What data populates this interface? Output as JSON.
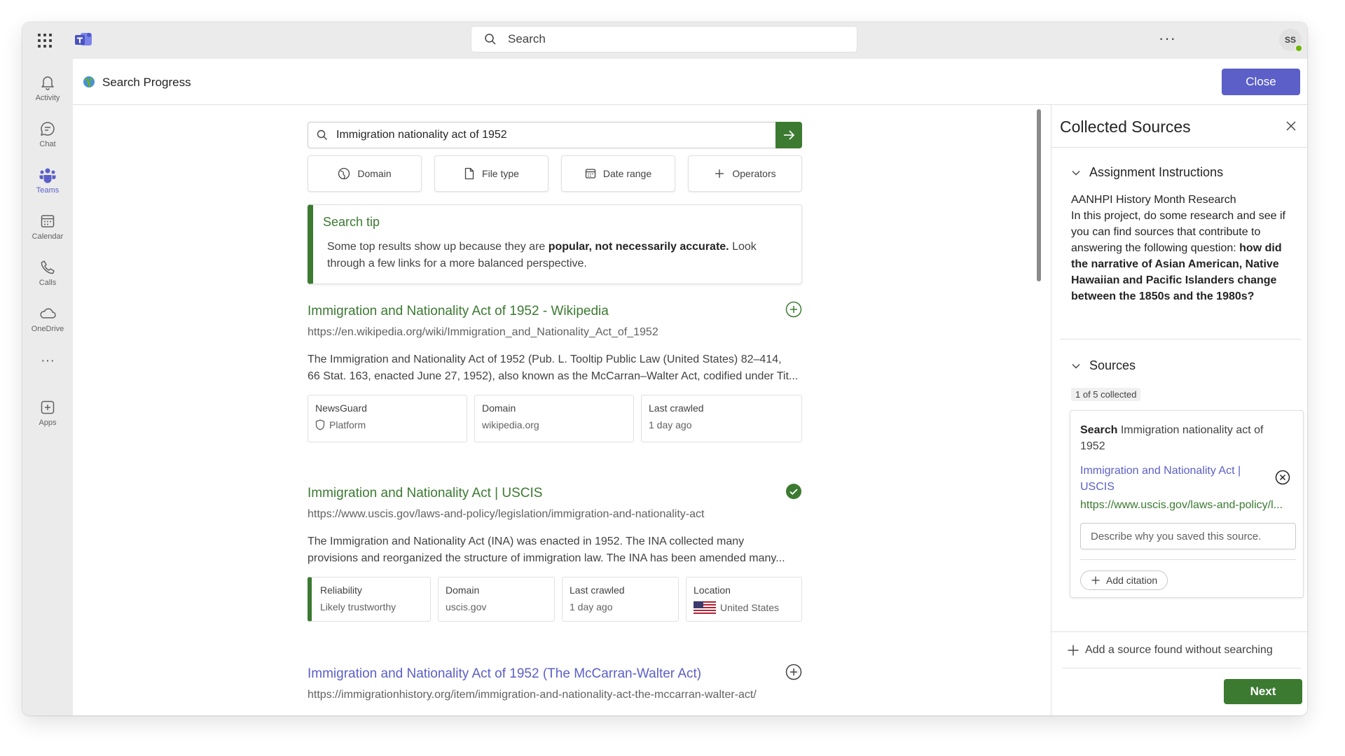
{
  "topbar": {
    "search_placeholder": "Search",
    "more": "···",
    "avatar_initials": "SS"
  },
  "rail": {
    "items": [
      {
        "label": "Activity",
        "icon": "bell-icon"
      },
      {
        "label": "Chat",
        "icon": "chat-icon"
      },
      {
        "label": "Teams",
        "icon": "teams-icon",
        "active": true
      },
      {
        "label": "Calendar",
        "icon": "calendar-icon"
      },
      {
        "label": "Calls",
        "icon": "phone-icon"
      },
      {
        "label": "OneDrive",
        "icon": "cloud-icon"
      },
      {
        "label": "Apps",
        "icon": "add-apps-icon"
      }
    ],
    "more": "···"
  },
  "app": {
    "title": "Search Progress",
    "close_label": "Close"
  },
  "query": {
    "value": "Immigration nationality act of 1952"
  },
  "filters": [
    {
      "label": "Domain",
      "icon": "globe-icon"
    },
    {
      "label": "File type",
      "icon": "file-icon"
    },
    {
      "label": "Date range",
      "icon": "calendar-icon"
    },
    {
      "label": "Operators",
      "icon": "plus-icon"
    }
  ],
  "tip": {
    "title": "Search tip",
    "pre": "Some top results show up because they are ",
    "bold": "popular, not necessarily accurate.",
    "post": " Look through a few links for a more balanced perspective."
  },
  "results": [
    {
      "title": "Immigration and Nationality Act of 1952 - Wikipedia",
      "url": "https://en.wikipedia.org/wiki/Immigration_and_Nationality_Act_of_1952",
      "desc1": "The Immigration and Nationality Act of 1952 (Pub. L. Tooltip Public Law (United States) 82–414,",
      "desc2": "66 Stat. 163, enacted June 27, 1952), also known as the McCarran–Walter Act, codified under Tit...",
      "saved": false,
      "cards": [
        {
          "label": "NewsGuard",
          "value": "Platform"
        },
        {
          "label": "Domain",
          "value": "wikipedia.org"
        },
        {
          "label": "Last crawled",
          "value": "1 day ago"
        }
      ]
    },
    {
      "title": "Immigration and Nationality Act | USCIS",
      "url": "https://www.uscis.gov/laws-and-policy/legislation/immigration-and-nationality-act",
      "desc1": "The Immigration and Nationality Act (INA) was enacted in 1952. The INA collected many",
      "desc2": "provisions and reorganized the structure of immigration law. The INA has been amended many...",
      "saved": true,
      "cards": [
        {
          "label": "Reliability",
          "value": "Likely trustworthy"
        },
        {
          "label": "Domain",
          "value": "uscis.gov"
        },
        {
          "label": "Last crawled",
          "value": "1 day ago"
        },
        {
          "label": "Location",
          "value": "United States"
        }
      ]
    },
    {
      "title": "Immigration and Nationality Act of 1952 (The McCarran-Walter Act)",
      "url": "https://immigrationhistory.org/item/immigration-and-nationality-act-the-mccarran-walter-act/",
      "saved": false
    }
  ],
  "panel": {
    "title": "Collected Sources",
    "instructions_heading": "Assignment Instructions",
    "assignment_title": "AANHPI History Month Research",
    "assignment_pre": "In this project, do some research and see if you can find sources that contribute to answering the following question: ",
    "assignment_bold": "how did the narrative of Asian American, Native Hawaiian and Pacific Islanders change between the 1850s and the 1980s?",
    "sources_heading": "Sources",
    "collected_badge": "1 of 5 collected",
    "source": {
      "search_label": "Search",
      "search_query": "Immigration nationality act of 1952",
      "title": "Immigration and Nationality Act | USCIS",
      "url": "https://www.uscis.gov/laws-and-policy/l...",
      "note_placeholder": "Describe why you saved this source.",
      "add_citation": "Add citation"
    },
    "add_without_search": "Add a source found without searching",
    "next_label": "Next"
  },
  "colors": {
    "accent_purple": "#5b5fc7",
    "accent_green": "#3c7a32"
  }
}
